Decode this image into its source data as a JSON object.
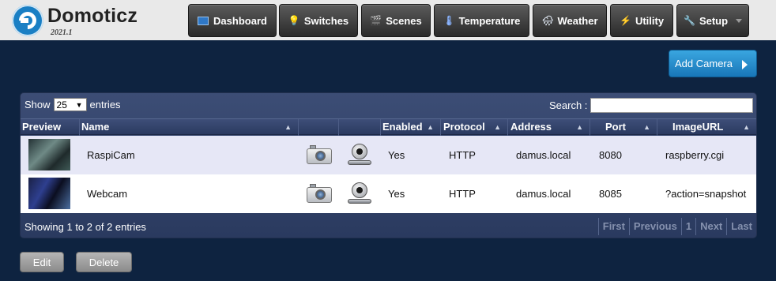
{
  "app": {
    "title": "Domoticz",
    "version": "2021.1"
  },
  "nav": [
    {
      "label": "Dashboard",
      "icon": "dashboard-icon"
    },
    {
      "label": "Switches",
      "icon": "lightbulb-icon"
    },
    {
      "label": "Scenes",
      "icon": "clapperboard-icon"
    },
    {
      "label": "Temperature",
      "icon": "thermometer-icon"
    },
    {
      "label": "Weather",
      "icon": "cloud-rain-icon"
    },
    {
      "label": "Utility",
      "icon": "utility-icon"
    },
    {
      "label": "Setup",
      "icon": "tools-icon"
    }
  ],
  "actions": {
    "add_camera": "Add Camera",
    "edit": "Edit",
    "delete": "Delete"
  },
  "table": {
    "show_label": "Show",
    "page_size": "25",
    "entries_label": "entries",
    "search_label": "Search :",
    "search_value": "",
    "columns": [
      "Preview",
      "Name",
      "",
      "",
      "Enabled",
      "Protocol",
      "Address",
      "Port",
      "ImageURL"
    ],
    "rows": [
      {
        "name": "RaspiCam",
        "enabled": "Yes",
        "protocol": "HTTP",
        "address": "damus.local",
        "port": "8080",
        "image_url": "raspberry.cgi"
      },
      {
        "name": "Webcam",
        "enabled": "Yes",
        "protocol": "HTTP",
        "address": "damus.local",
        "port": "8085",
        "image_url": "?action=snapshot"
      }
    ],
    "info": "Showing 1 to 2 of 2 entries",
    "pager": [
      "First",
      "Previous",
      "1",
      "Next",
      "Last"
    ]
  },
  "colors": {
    "background": "#0e2340",
    "accent": "#1876b8",
    "row_highlight": "#e6e7f6"
  }
}
